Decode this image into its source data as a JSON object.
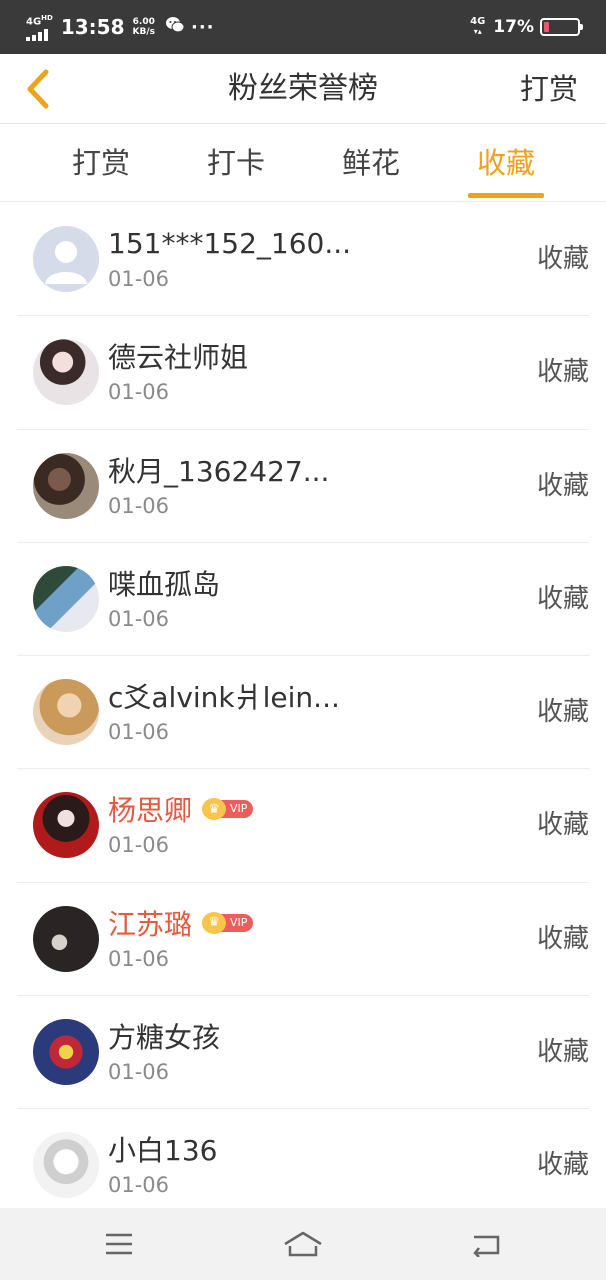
{
  "status_bar": {
    "network_type": "4G",
    "network_sup": "HD",
    "time": "13:58",
    "speed_value": "6.00",
    "speed_unit": "KB/s",
    "wechat_icon": "wechat-icon",
    "more_dots": "···",
    "cell_network": "4G",
    "battery_percent": "17%",
    "battery_level": 0.17,
    "battery_fill_color": "#e8586a"
  },
  "header": {
    "back_icon": "chevron-left-icon",
    "title": "粉丝荣誉榜",
    "action_label": "打赏",
    "accent_color": "#f0a21b"
  },
  "tabs": [
    {
      "label": "打赏",
      "active": false
    },
    {
      "label": "打卡",
      "active": false
    },
    {
      "label": "鲜花",
      "active": false
    },
    {
      "label": "收藏",
      "active": true
    }
  ],
  "list": [
    {
      "name": "151***152_160...",
      "date": "01-06",
      "action": "收藏",
      "vip": false
    },
    {
      "name": "德云社师姐",
      "date": "01-06",
      "action": "收藏",
      "vip": false
    },
    {
      "name": "秋月_1362427...",
      "date": "01-06",
      "action": "收藏",
      "vip": false
    },
    {
      "name": "喋血孤岛",
      "date": "01-06",
      "action": "收藏",
      "vip": false
    },
    {
      "name": "c爻alvink爿lein...",
      "date": "01-06",
      "action": "收藏",
      "vip": false
    },
    {
      "name": "杨思卿",
      "date": "01-06",
      "action": "收藏",
      "vip": true,
      "vip_label": "VIP"
    },
    {
      "name": "江苏璐",
      "date": "01-06",
      "action": "收藏",
      "vip": true,
      "vip_label": "VIP"
    },
    {
      "name": "方糖女孩",
      "date": "01-06",
      "action": "收藏",
      "vip": false
    },
    {
      "name": "小白136",
      "date": "01-06",
      "action": "收藏",
      "vip": false
    }
  ],
  "nav_bar": {
    "items": [
      "menu-icon",
      "home-icon",
      "back-icon"
    ]
  }
}
